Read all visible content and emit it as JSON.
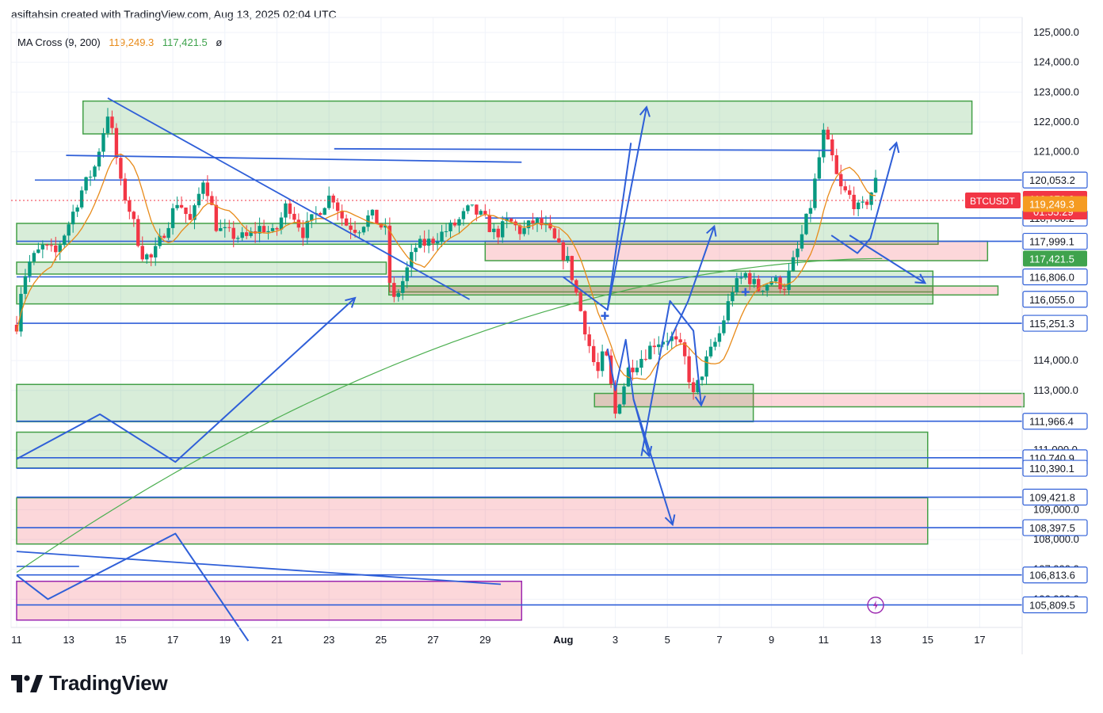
{
  "header": {
    "author_line": "asiftahsin created with TradingView.com, Aug 13, 2025 02:04 UTC"
  },
  "indicator": {
    "name": "MA Cross (9, 200)",
    "ma_fast_value": "119,249.3",
    "ma_slow_value": "117,421.5",
    "settings_glyph": "ø",
    "colors": {
      "fast": "#e88b1a",
      "slow": "#4caf50"
    }
  },
  "brand": {
    "name": "TradingView",
    "logo_icon": "tradingview-logo-icon"
  },
  "symbol_badge": {
    "symbol": "BTCUSDT",
    "color": "#f23645"
  },
  "price_badges": [
    {
      "id": "last",
      "value": "119,370.2",
      "sub": "01:55:29",
      "bg": "#f23645",
      "fg": "#ffffff",
      "y": 119370.2
    },
    {
      "id": "ma9",
      "value": "119,249.3",
      "bg": "#f59b22",
      "fg": "#ffffff",
      "y": 119249.3
    },
    {
      "id": "ma200",
      "value": "117,421.5",
      "bg": "#3fa34d",
      "fg": "#ffffff",
      "y": 117421.5
    }
  ],
  "level_labels": [
    {
      "value": "120,053.2",
      "y": 120053.2
    },
    {
      "value": "118,780.2",
      "y": 118780.2
    },
    {
      "value": "117,999.1",
      "y": 117999.1
    },
    {
      "value": "116,806.0",
      "y": 116806.0
    },
    {
      "value": "116,055.0",
      "y": 116055.0
    },
    {
      "value": "115,251.3",
      "y": 115251.3
    },
    {
      "value": "111,966.4",
      "y": 111966.4
    },
    {
      "value": "110,740.9",
      "y": 110740.9
    },
    {
      "value": "110,390.1",
      "y": 110390.1
    },
    {
      "value": "109,421.8",
      "y": 109421.8
    },
    {
      "value": "108,397.5",
      "y": 108397.5
    },
    {
      "value": "106,813.6",
      "y": 106813.6
    },
    {
      "value": "105,809.5",
      "y": 105809.5
    }
  ],
  "chart_data": {
    "type": "candlestick",
    "symbol": "BTCUSDT",
    "y_axis": {
      "min": 104800,
      "max": 125200,
      "ticks": [
        125000,
        124000,
        123000,
        122000,
        121000,
        114000,
        113000,
        111000,
        109000,
        108000,
        107000,
        106000
      ],
      "tick_labels": [
        "125,000.0",
        "124,000.0",
        "123,000.0",
        "122,000.0",
        "121,000.0",
        "114,000.0",
        "113,000.0",
        "111,000.0",
        "109,000.0",
        "108,000.0",
        "107,000.0",
        "106,000.0"
      ]
    },
    "x_axis": {
      "start": "Jul 11",
      "end": "Aug 18",
      "tick_labels": [
        {
          "label": "11",
          "day": 0
        },
        {
          "label": "13",
          "day": 2
        },
        {
          "label": "15",
          "day": 4
        },
        {
          "label": "17",
          "day": 6
        },
        {
          "label": "19",
          "day": 8
        },
        {
          "label": "21",
          "day": 10
        },
        {
          "label": "23",
          "day": 12
        },
        {
          "label": "25",
          "day": 14
        },
        {
          "label": "27",
          "day": 16
        },
        {
          "label": "29",
          "day": 18
        },
        {
          "label": "Aug",
          "day": 21
        },
        {
          "label": "3",
          "day": 23
        },
        {
          "label": "5",
          "day": 25
        },
        {
          "label": "7",
          "day": 27
        },
        {
          "label": "9",
          "day": 29
        },
        {
          "label": "11",
          "day": 31
        },
        {
          "label": "13",
          "day": 33
        },
        {
          "label": "15",
          "day": 35
        },
        {
          "label": "17",
          "day": 37
        }
      ]
    },
    "series": [
      {
        "name": "BTCUSDT",
        "kind": "candles"
      },
      {
        "name": "MA 9",
        "kind": "line",
        "color": "#e88b1a"
      },
      {
        "name": "MA 200",
        "kind": "line",
        "color": "#4caf50"
      }
    ],
    "zones": [
      {
        "kind": "green",
        "day_from": 2.55,
        "day_to": 36.7,
        "y_top": 122700,
        "y_bottom": 121600
      },
      {
        "kind": "green",
        "day_from": 0,
        "day_to": 35.4,
        "y_top": 118600,
        "y_bottom": 117900
      },
      {
        "kind": "green",
        "day_from": 0,
        "day_to": 14.2,
        "y_top": 117300,
        "y_bottom": 116900
      },
      {
        "kind": "green",
        "day_from": 0,
        "day_to": 35.2,
        "y_top": 116500,
        "y_bottom": 115900
      },
      {
        "kind": "green",
        "day_from": 14.3,
        "day_to": 35.2,
        "y_top": 117000,
        "y_bottom": 116300
      },
      {
        "kind": "green",
        "day_from": 0,
        "day_to": 28.3,
        "y_top": 113200,
        "y_bottom": 111950
      },
      {
        "kind": "green",
        "day_from": 0,
        "day_to": 35.0,
        "y_top": 111600,
        "y_bottom": 110400
      },
      {
        "kind": "pink",
        "day_from": 18.0,
        "day_to": 37.3,
        "y_top": 118000,
        "y_bottom": 117350
      },
      {
        "kind": "pink",
        "day_from": 14.3,
        "day_to": 37.7,
        "y_top": 116500,
        "y_bottom": 116200
      },
      {
        "kind": "pink",
        "day_from": 22.2,
        "day_to": 38.7,
        "y_top": 112900,
        "y_bottom": 112450
      },
      {
        "kind": "pink",
        "day_from": 0,
        "day_to": 35.0,
        "y_top": 109400,
        "y_bottom": 107850
      },
      {
        "kind": "pink",
        "day_from": 0,
        "day_to": 19.4,
        "y_top": 106600,
        "y_bottom": 105300
      }
    ],
    "horizontal_lines": [
      {
        "y": 120053.2,
        "day_from": 0.7,
        "day_to": 39.4
      },
      {
        "y": 118780.2,
        "day_from": 18.0,
        "day_to": 39.4
      },
      {
        "y": 117999.1,
        "day_from": 0,
        "day_to": 39.4
      },
      {
        "y": 116806.0,
        "day_from": 0,
        "day_to": 39.4
      },
      {
        "y": 115251.3,
        "day_from": 0,
        "day_to": 39.4
      },
      {
        "y": 111966.4,
        "day_from": 0,
        "day_to": 39.4
      },
      {
        "y": 110740.9,
        "day_from": 0,
        "day_to": 39.4
      },
      {
        "y": 110390.1,
        "day_from": 0,
        "day_to": 39.4
      },
      {
        "y": 109421.8,
        "day_from": 0,
        "day_to": 39.4
      },
      {
        "y": 108397.5,
        "day_from": 0,
        "day_to": 39.4
      },
      {
        "y": 106813.6,
        "day_from": 0,
        "day_to": 39.4
      },
      {
        "y": 105809.5,
        "day_from": 0,
        "day_to": 39.4
      },
      {
        "y": 107100,
        "day_from": 0,
        "day_to": 2.4
      }
    ],
    "trend_lines": [
      {
        "d1": 1.9,
        "y1": 120880,
        "d2": 19.4,
        "y2": 120650
      },
      {
        "d1": 3.5,
        "y1": 122800,
        "d2": 17.4,
        "y2": 116050
      },
      {
        "d1": 0,
        "y1": 107600,
        "d2": 18.6,
        "y2": 106500
      },
      {
        "d1": 12.2,
        "y1": 121100,
        "d2": 31.3,
        "y2": 121050
      }
    ],
    "arrow_paths": [
      {
        "points": [
          [
            0,
            110700
          ],
          [
            3.2,
            112200
          ],
          [
            6.1,
            110600
          ],
          [
            13.0,
            116100
          ]
        ],
        "arrow": true
      },
      {
        "points": [
          [
            0,
            106800
          ],
          [
            1.2,
            106000
          ],
          [
            6.1,
            108200
          ],
          [
            8.9,
            104600
          ]
        ],
        "arrow": false
      },
      {
        "points": [
          [
            21.0,
            116800
          ],
          [
            22.7,
            115700
          ],
          [
            23.6,
            121300
          ]
        ],
        "arrow": false
      },
      {
        "points": [
          [
            22.7,
            115700
          ],
          [
            24.2,
            122500
          ]
        ],
        "arrow": true
      },
      {
        "points": [
          [
            22.7,
            114400
          ],
          [
            23.0,
            113000
          ],
          [
            23.4,
            114700
          ],
          [
            23.7,
            112700
          ],
          [
            24.3,
            110800
          ]
        ],
        "arrow": true
      },
      {
        "points": [
          [
            23.7,
            112700
          ],
          [
            25.2,
            108500
          ]
        ],
        "arrow": true
      },
      {
        "points": [
          [
            24.0,
            110800
          ],
          [
            25.1,
            116000
          ],
          [
            26.0,
            115000
          ],
          [
            26.3,
            112500
          ]
        ],
        "arrow": true
      },
      {
        "points": [
          [
            25.0,
            114500
          ],
          [
            25.8,
            116000
          ],
          [
            26.8,
            118500
          ]
        ],
        "arrow": true
      },
      {
        "points": [
          [
            31.3,
            118200
          ],
          [
            32.3,
            117600
          ],
          [
            32.8,
            118100
          ],
          [
            33.8,
            121300
          ]
        ],
        "arrow": true
      },
      {
        "points": [
          [
            32.0,
            118200
          ],
          [
            34.9,
            116600
          ]
        ],
        "arrow": true
      }
    ],
    "markers": [
      {
        "day": 22.6,
        "y": 115500,
        "glyph": "+"
      },
      {
        "day": 28.0,
        "y": 116300,
        "glyph": "+"
      },
      {
        "day": 33.0,
        "y": 105800,
        "glyph": "lightning"
      }
    ],
    "candles_anchor_closes": [
      [
        0,
        115200
      ],
      [
        0.2,
        116600
      ],
      [
        0.5,
        117300
      ],
      [
        1.0,
        117800
      ],
      [
        1.5,
        117600
      ],
      [
        2.0,
        118600
      ],
      [
        2.5,
        119700
      ],
      [
        3.0,
        120500
      ],
      [
        3.5,
        122300
      ],
      [
        3.7,
        121500
      ],
      [
        4.0,
        119900
      ],
      [
        4.4,
        118900
      ],
      [
        4.8,
        117600
      ],
      [
        5.2,
        117400
      ],
      [
        5.7,
        118400
      ],
      [
        6.2,
        119400
      ],
      [
        6.7,
        118600
      ],
      [
        7.2,
        120200
      ],
      [
        7.7,
        118400
      ],
      [
        8.3,
        118200
      ],
      [
        8.8,
        118100
      ],
      [
        9.4,
        118500
      ],
      [
        9.9,
        118200
      ],
      [
        10.4,
        119300
      ],
      [
        11.0,
        118300
      ],
      [
        11.5,
        118900
      ],
      [
        12.1,
        119600
      ],
      [
        12.6,
        118600
      ],
      [
        13.1,
        118400
      ],
      [
        13.6,
        118900
      ],
      [
        14.2,
        118300
      ],
      [
        14.4,
        115800
      ],
      [
        14.9,
        116800
      ],
      [
        15.3,
        117800
      ],
      [
        15.9,
        118000
      ],
      [
        16.4,
        118300
      ],
      [
        16.9,
        118600
      ],
      [
        17.4,
        119100
      ],
      [
        17.9,
        118800
      ],
      [
        18.4,
        118200
      ],
      [
        18.9,
        118700
      ],
      [
        19.4,
        118300
      ],
      [
        19.9,
        118700
      ],
      [
        20.4,
        118400
      ],
      [
        20.8,
        117800
      ],
      [
        21.2,
        117300
      ],
      [
        21.6,
        115900
      ],
      [
        22.0,
        114500
      ],
      [
        22.3,
        113500
      ],
      [
        22.6,
        114400
      ],
      [
        23.0,
        112200
      ],
      [
        23.5,
        113700
      ],
      [
        24.0,
        114100
      ],
      [
        24.5,
        114600
      ],
      [
        25.1,
        114800
      ],
      [
        25.6,
        114300
      ],
      [
        26.0,
        112800
      ],
      [
        26.5,
        114000
      ],
      [
        27.0,
        114900
      ],
      [
        27.5,
        116400
      ],
      [
        28.0,
        116900
      ],
      [
        28.5,
        116400
      ],
      [
        29.0,
        116700
      ],
      [
        29.5,
        116500
      ],
      [
        30.0,
        117700
      ],
      [
        30.5,
        119200
      ],
      [
        31.0,
        121600
      ],
      [
        31.3,
        120900
      ],
      [
        31.6,
        119800
      ],
      [
        32.0,
        119500
      ],
      [
        32.4,
        119000
      ],
      [
        32.7,
        119400
      ],
      [
        33.0,
        120000
      ],
      [
        33.1,
        119400
      ]
    ]
  }
}
